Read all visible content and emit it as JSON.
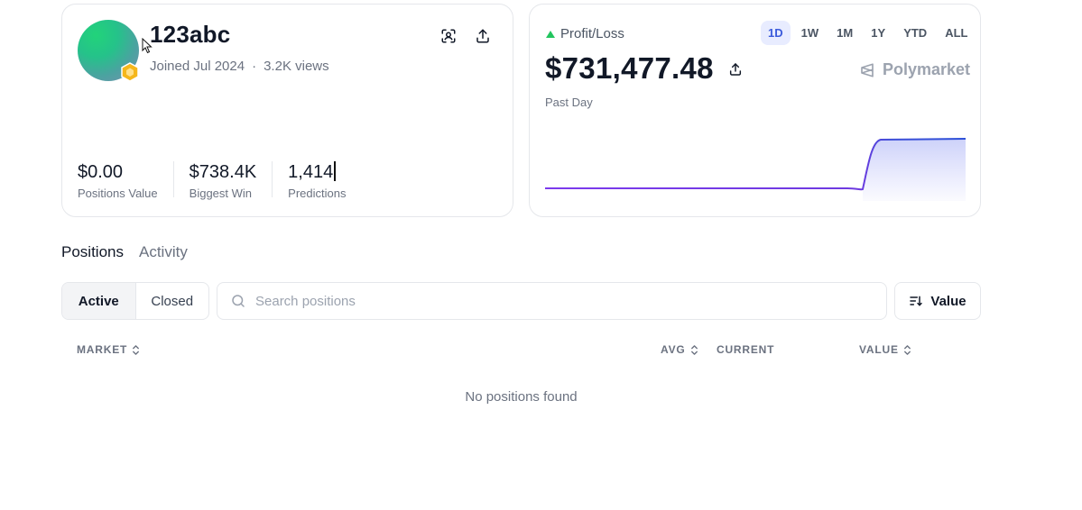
{
  "profile": {
    "username": "123abc",
    "joined": "Joined Jul 2024",
    "separator": "·",
    "views": "3.2K views",
    "stats": [
      {
        "value": "$0.00",
        "label": "Positions Value"
      },
      {
        "value": "$738.4K",
        "label": "Biggest Win"
      },
      {
        "value": "1,414",
        "label": "Predictions"
      }
    ]
  },
  "pnl": {
    "label": "Profit/Loss",
    "value": "$731,477.48",
    "period": "Past Day",
    "brand": "Polymarket",
    "ranges": [
      "1D",
      "1W",
      "1M",
      "1Y",
      "YTD",
      "ALL"
    ],
    "active_range": "1D"
  },
  "tabs": [
    {
      "label": "Positions",
      "active": true
    },
    {
      "label": "Activity",
      "active": false
    }
  ],
  "filter": {
    "active_label": "Active",
    "closed_label": "Closed"
  },
  "search": {
    "placeholder": "Search positions",
    "value": ""
  },
  "sort": {
    "label": "Value"
  },
  "table": {
    "columns": {
      "market": "MARKET",
      "avg": "AVG",
      "current": "CURRENT",
      "value": "VALUE"
    },
    "empty_message": "No positions found"
  },
  "colors": {
    "accent": "#3b5bdb",
    "positive": "#22c55e",
    "line_start": "#7c3aed",
    "line_end": "#2b4fd8"
  },
  "icons": {
    "badge": "hexagon-badge-icon",
    "scan": "scan-user-icon",
    "share": "share-upload-icon",
    "brand": "polymarket-logo-icon",
    "search": "search-icon",
    "sort": "sort-descending-icon",
    "sort_toggle": "sort-toggle-icon"
  }
}
